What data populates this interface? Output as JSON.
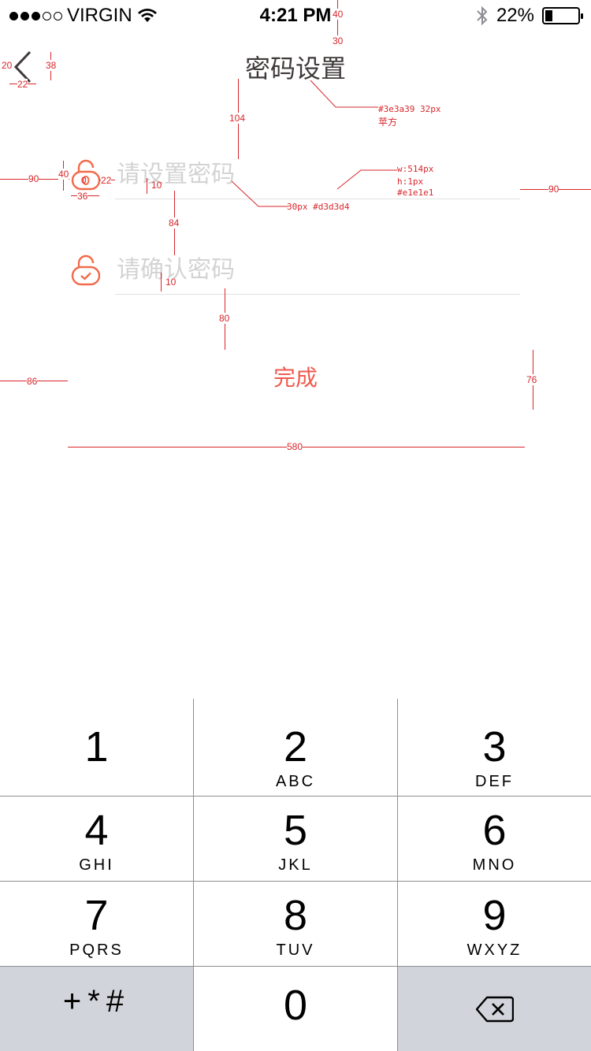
{
  "status_bar": {
    "carrier": "VIRGIN",
    "time": "4:21 PM",
    "battery": "22%",
    "battery_level": 0.22,
    "signal_bars_filled": 3,
    "signal_bars_total": 5
  },
  "nav": {
    "title": "密码设置",
    "back_icon": "chevron-left-icon"
  },
  "form": {
    "password_placeholder": "请设置密码",
    "confirm_placeholder": "请确认密码",
    "password_icon": "lock-icon",
    "confirm_icon": "lock-check-icon",
    "submit_label": "完成"
  },
  "colors": {
    "title": "#3e3a39",
    "placeholder": "#d3d3d4",
    "divider": "#e1e1e1",
    "accent_start": "#f0505a",
    "accent_end": "#f5883a",
    "annotation": "#d9262b"
  },
  "annotations": {
    "a1": "40",
    "a2": "30",
    "a3": "20",
    "a4": "38",
    "a5": "22",
    "a6": "#3e3a39   32px",
    "a7": "苹方",
    "a8": "104",
    "a9": "w:514px",
    "a10": "h:1px",
    "a11": "#e1e1e1",
    "a12": "90",
    "a13": "40",
    "a14": "22",
    "a15": "36",
    "a16": "10",
    "a17": "30px    #d3d3d4",
    "a18": "90",
    "a19": "84",
    "a20": "10",
    "a21": "80",
    "a22": "86",
    "a23": "76",
    "a24": "580",
    "a25": "0"
  },
  "keypad": {
    "keys": [
      {
        "num": "1",
        "letters": ""
      },
      {
        "num": "2",
        "letters": "ABC"
      },
      {
        "num": "3",
        "letters": "DEF"
      },
      {
        "num": "4",
        "letters": "GHI"
      },
      {
        "num": "5",
        "letters": "JKL"
      },
      {
        "num": "6",
        "letters": "MNO"
      },
      {
        "num": "7",
        "letters": "PQRS"
      },
      {
        "num": "8",
        "letters": "TUV"
      },
      {
        "num": "9",
        "letters": "WXYZ"
      },
      {
        "num": "+*#",
        "letters": ""
      },
      {
        "num": "0",
        "letters": ""
      },
      {
        "num": "",
        "letters": ""
      }
    ],
    "delete_icon": "backspace-icon"
  }
}
